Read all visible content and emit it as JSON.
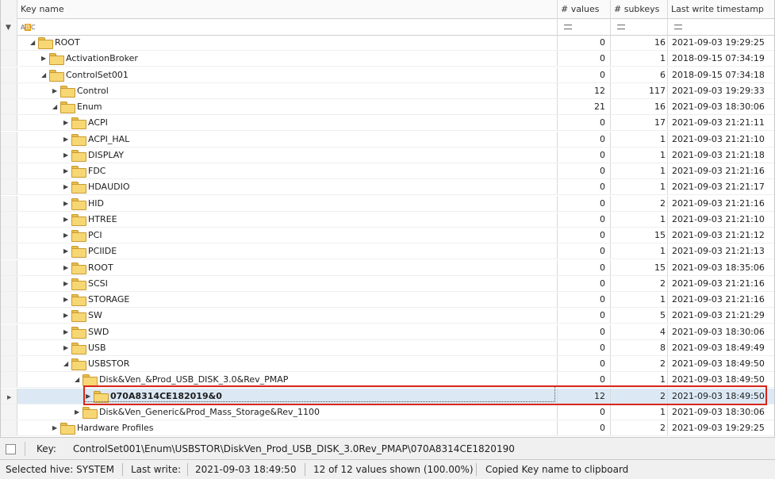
{
  "columns": {
    "key_name": "Key name",
    "values": "# values",
    "subkeys": "# subkeys",
    "last_write": "Last write timestamp"
  },
  "filter_row": {
    "abc_prefix": "A",
    "abc_mid": "B",
    "abc_suffix": "C"
  },
  "tree": [
    {
      "name": "ROOT",
      "values": "0",
      "subkeys": "16",
      "ts": "2021-09-03 19:29:25",
      "depth": 0,
      "toggle": "open"
    },
    {
      "name": "ActivationBroker",
      "values": "0",
      "subkeys": "1",
      "ts": "2018-09-15 07:34:19",
      "depth": 1,
      "toggle": "closed"
    },
    {
      "name": "ControlSet001",
      "values": "0",
      "subkeys": "6",
      "ts": "2018-09-15 07:34:18",
      "depth": 1,
      "toggle": "open"
    },
    {
      "name": "Control",
      "values": "12",
      "subkeys": "117",
      "ts": "2021-09-03 19:29:33",
      "depth": 2,
      "toggle": "closed"
    },
    {
      "name": "Enum",
      "values": "21",
      "subkeys": "16",
      "ts": "2021-09-03 18:30:06",
      "depth": 2,
      "toggle": "open"
    },
    {
      "name": "ACPI",
      "values": "0",
      "subkeys": "17",
      "ts": "2021-09-03 21:21:11",
      "depth": 3,
      "toggle": "closed"
    },
    {
      "name": "ACPI_HAL",
      "values": "0",
      "subkeys": "1",
      "ts": "2021-09-03 21:21:10",
      "depth": 3,
      "toggle": "closed"
    },
    {
      "name": "DISPLAY",
      "values": "0",
      "subkeys": "1",
      "ts": "2021-09-03 21:21:18",
      "depth": 3,
      "toggle": "closed"
    },
    {
      "name": "FDC",
      "values": "0",
      "subkeys": "1",
      "ts": "2021-09-03 21:21:16",
      "depth": 3,
      "toggle": "closed"
    },
    {
      "name": "HDAUDIO",
      "values": "0",
      "subkeys": "1",
      "ts": "2021-09-03 21:21:17",
      "depth": 3,
      "toggle": "closed"
    },
    {
      "name": "HID",
      "values": "0",
      "subkeys": "2",
      "ts": "2021-09-03 21:21:16",
      "depth": 3,
      "toggle": "closed"
    },
    {
      "name": "HTREE",
      "values": "0",
      "subkeys": "1",
      "ts": "2021-09-03 21:21:10",
      "depth": 3,
      "toggle": "closed"
    },
    {
      "name": "PCI",
      "values": "0",
      "subkeys": "15",
      "ts": "2021-09-03 21:21:12",
      "depth": 3,
      "toggle": "closed"
    },
    {
      "name": "PCIIDE",
      "values": "0",
      "subkeys": "1",
      "ts": "2021-09-03 21:21:13",
      "depth": 3,
      "toggle": "closed"
    },
    {
      "name": "ROOT",
      "values": "0",
      "subkeys": "15",
      "ts": "2021-09-03 18:35:06",
      "depth": 3,
      "toggle": "closed"
    },
    {
      "name": "SCSI",
      "values": "0",
      "subkeys": "2",
      "ts": "2021-09-03 21:21:16",
      "depth": 3,
      "toggle": "closed"
    },
    {
      "name": "STORAGE",
      "values": "0",
      "subkeys": "1",
      "ts": "2021-09-03 21:21:16",
      "depth": 3,
      "toggle": "closed"
    },
    {
      "name": "SW",
      "values": "0",
      "subkeys": "5",
      "ts": "2021-09-03 21:21:29",
      "depth": 3,
      "toggle": "closed"
    },
    {
      "name": "SWD",
      "values": "0",
      "subkeys": "4",
      "ts": "2021-09-03 18:30:06",
      "depth": 3,
      "toggle": "closed"
    },
    {
      "name": "USB",
      "values": "0",
      "subkeys": "8",
      "ts": "2021-09-03 18:49:49",
      "depth": 3,
      "toggle": "closed"
    },
    {
      "name": "USBSTOR",
      "values": "0",
      "subkeys": "2",
      "ts": "2021-09-03 18:49:50",
      "depth": 3,
      "toggle": "open"
    },
    {
      "name": "Disk&Ven_&Prod_USB_DISK_3.0&Rev_PMAP",
      "values": "0",
      "subkeys": "1",
      "ts": "2021-09-03 18:49:50",
      "depth": 4,
      "toggle": "open"
    },
    {
      "name": "070A8314CE182019&0",
      "values": "12",
      "subkeys": "2",
      "ts": "2021-09-03 18:49:50",
      "depth": 5,
      "toggle": "closed",
      "selected": true
    },
    {
      "name": "Disk&Ven_Generic&Prod_Mass_Storage&Rev_1100",
      "values": "0",
      "subkeys": "1",
      "ts": "2021-09-03 18:30:06",
      "depth": 4,
      "toggle": "closed"
    },
    {
      "name": "Hardware Profiles",
      "values": "0",
      "subkeys": "2",
      "ts": "2021-09-03 19:29:25",
      "depth": 2,
      "toggle": "closed"
    }
  ],
  "key_bar": {
    "label": "Key:",
    "path": "ControlSet001\\Enum\\USBSTOR\\DiskVen_Prod_USB_DISK_3.0Rev_PMAP\\070A8314CE1820190"
  },
  "status": {
    "hive": "Selected hive: SYSTEM",
    "last_write_label": "Last write:",
    "last_write_value": "2021-09-03 18:49:50",
    "values_shown": "12 of 12 values shown (100.00%)",
    "message": "Copied Key name to clipboard"
  },
  "colors": {
    "selection": "#dce9f5",
    "highlight_border": "#d9261c",
    "folder": "#f7d774"
  }
}
